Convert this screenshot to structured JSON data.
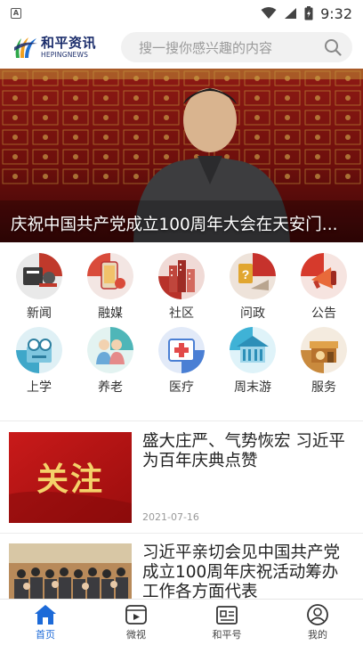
{
  "status_bar": {
    "app_indicator": "A",
    "time": "9:32",
    "icons": [
      "wifi-icon",
      "signal-icon",
      "battery-icon"
    ]
  },
  "header": {
    "logo_cn": "和平资讯",
    "logo_en": "HEPINGNEWS",
    "search_placeholder": "搜一搜你感兴趣的内容",
    "search_icon": "search-icon"
  },
  "hero": {
    "caption": "庆祝中国共产党成立100周年大会在天安门..."
  },
  "categories": [
    {
      "label": "新闻",
      "icon": "news-icon",
      "color": "#c0392b"
    },
    {
      "label": "融媒",
      "icon": "media-icon",
      "color": "#d94b3a"
    },
    {
      "label": "社区",
      "icon": "community-icon",
      "color": "#b8322a"
    },
    {
      "label": "问政",
      "icon": "inquiry-icon",
      "color": "#c6322c"
    },
    {
      "label": "公告",
      "icon": "announcement-icon",
      "color": "#d63a2c"
    },
    {
      "label": "上学",
      "icon": "school-icon",
      "color": "#3fa7c9"
    },
    {
      "label": "养老",
      "icon": "elderly-care-icon",
      "color": "#4fb6b8"
    },
    {
      "label": "医疗",
      "icon": "medical-icon",
      "color": "#4a7fd4"
    },
    {
      "label": "周末游",
      "icon": "weekend-travel-icon",
      "color": "#3fb2d6"
    },
    {
      "label": "服务",
      "icon": "service-icon",
      "color": "#c98a3d"
    }
  ],
  "news": [
    {
      "title": "盛大庄严、气势恢宏 习近平为百年庆典点赞",
      "date": "2021-07-16",
      "thumb_text": "关注"
    },
    {
      "title": "习近平亲切会见中国共产党成立100周年庆祝活动筹办工作各方面代表",
      "date": ""
    }
  ],
  "tabs": [
    {
      "label": "首页",
      "icon": "home-icon",
      "active": true
    },
    {
      "label": "微视",
      "icon": "video-icon",
      "active": false
    },
    {
      "label": "和平号",
      "icon": "account-card-icon",
      "active": false
    },
    {
      "label": "我的",
      "icon": "profile-icon",
      "active": false
    }
  ],
  "colors": {
    "accent": "#1c6ad8",
    "brand_dark": "#1b2d6b"
  }
}
